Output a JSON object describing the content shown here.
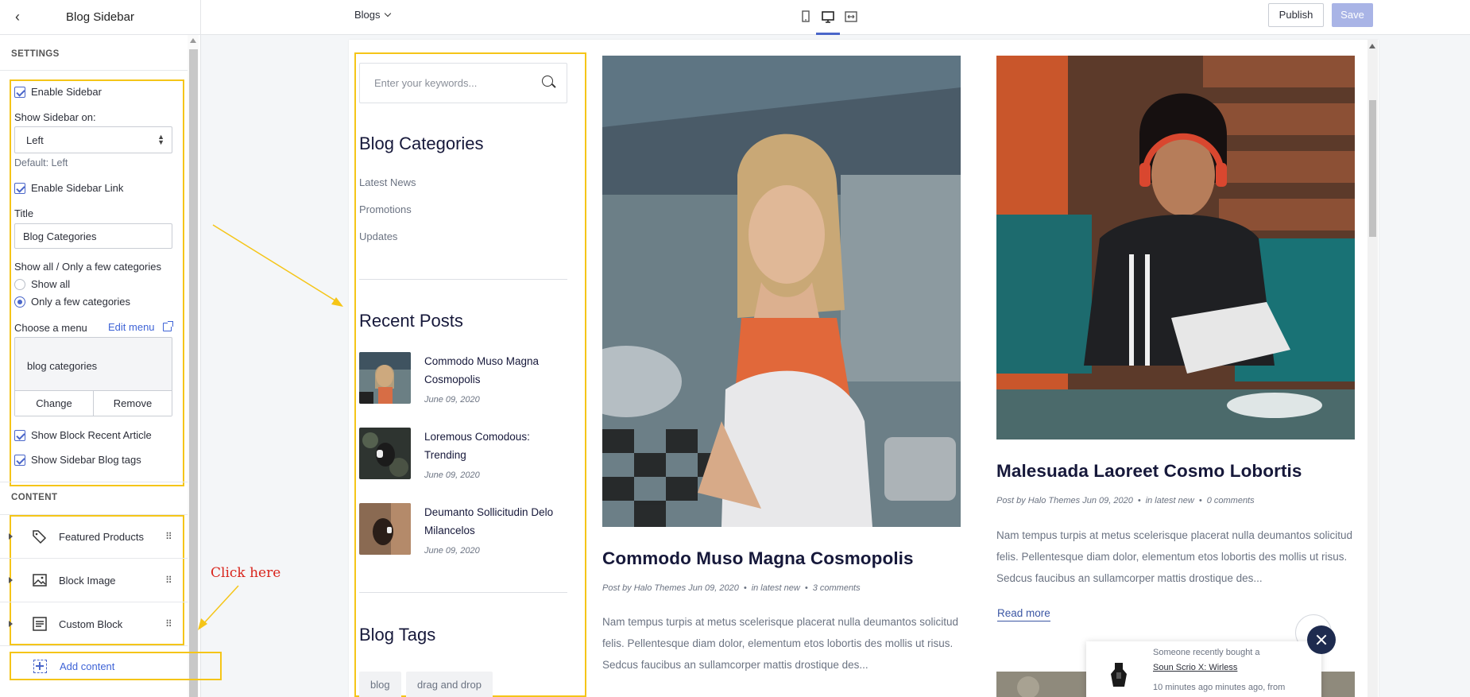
{
  "panel": {
    "title": "Blog Sidebar",
    "settings_heading": "SETTINGS",
    "enable_sidebar": "Enable Sidebar",
    "show_sidebar_on_label": "Show Sidebar on:",
    "show_sidebar_on_value": "Left",
    "default_hint": "Default: Left",
    "enable_sidebar_link": "Enable Sidebar Link",
    "title_label": "Title",
    "title_value": "Blog Categories",
    "show_all_label": "Show all / Only a few categories",
    "radio_show_all": "Show all",
    "radio_few": "Only a few categories",
    "choose_menu_label": "Choose a menu",
    "edit_menu": "Edit menu",
    "menu_value": "blog categories",
    "change_btn": "Change",
    "remove_btn": "Remove",
    "show_recent_article": "Show Block Recent Article",
    "show_tags": "Show Sidebar Blog tags",
    "content_heading": "CONTENT",
    "content_items": [
      "Featured Products",
      "Block Image",
      "Custom Block"
    ],
    "add_content": "Add content"
  },
  "annotation": {
    "click_here": "Click here",
    "color": "#f5c518",
    "text_color": "#d9251d"
  },
  "topbar": {
    "page_select": "Blogs",
    "publish": "Publish",
    "save": "Save"
  },
  "sidebar": {
    "search_placeholder": "Enter your keywords...",
    "categories_heading": "Blog Categories",
    "categories": [
      "Latest News",
      "Promotions",
      "Updates"
    ],
    "recent_heading": "Recent Posts",
    "recent_posts": [
      {
        "title": "Commodo Muso Magna Cosmopolis",
        "date": "June 09, 2020"
      },
      {
        "title": "Loremous Comodous: Trending",
        "date": "June 09, 2020"
      },
      {
        "title": "Deumanto Sollicitudin Delo Milancelos",
        "date": "June 09, 2020"
      }
    ],
    "tags_heading": "Blog Tags",
    "tags": [
      "blog",
      "drag and drop"
    ]
  },
  "articles": [
    {
      "title": "Commodo Muso Magna Cosmopolis",
      "author": "Post by Halo Themes Jun 09, 2020",
      "category": "in latest new",
      "comments": "3 comments",
      "excerpt": "Nam tempus turpis at metus scelerisque placerat nulla deumantos solicitud felis. Pellentesque diam dolor, elementum etos lobortis des mollis ut risus. Sedcus faucibus an sullamcorper mattis drostique des..."
    },
    {
      "title": "Malesuada Laoreet Cosmo Lobortis",
      "author": "Post by Halo Themes Jun 09, 2020",
      "category": "in latest new",
      "comments": "0 comments",
      "excerpt": "Nam tempus turpis at metus scelerisque placerat nulla deumantos solicitud felis. Pellentesque diam dolor, elementum etos lobortis des mollis ut risus. Sedcus faucibus an sullamcorper mattis drostique des...",
      "read_more": "Read more"
    }
  ],
  "popup": {
    "line1": "Someone recently bought a",
    "product": "Soun Scrio X: Wirless",
    "line3": "10 minutes ago minutes ago, from"
  }
}
